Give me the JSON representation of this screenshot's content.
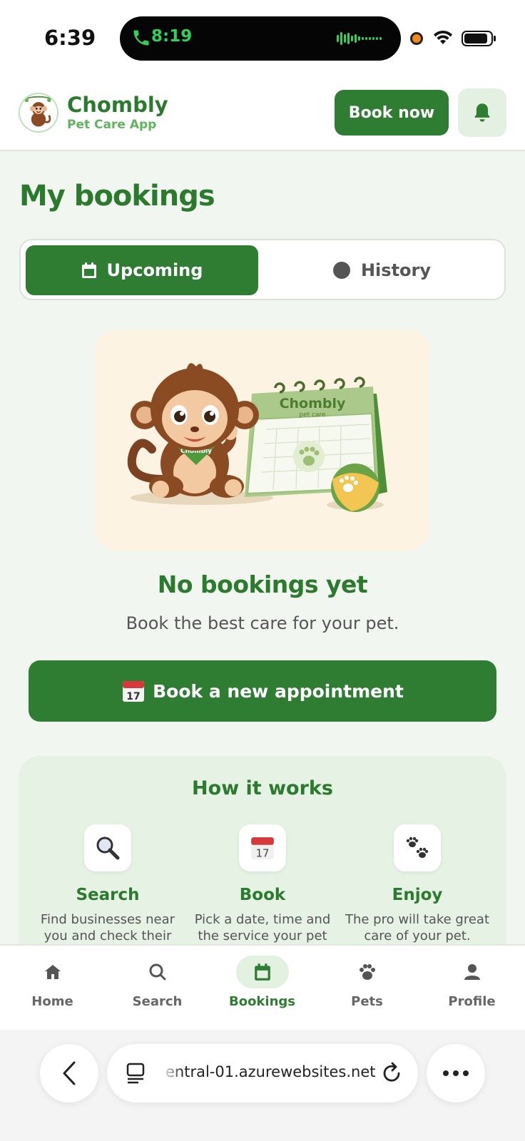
{
  "status_bar": {
    "time": "6:39",
    "call_timer": "8:19"
  },
  "header": {
    "brand_name": "Chombly",
    "brand_tagline": "Pet Care App",
    "book_now_label": "Book now"
  },
  "page": {
    "title": "My bookings",
    "tabs": [
      {
        "label": "Upcoming",
        "icon": "calendar-icon",
        "active": true
      },
      {
        "label": "History",
        "icon": "circle-icon",
        "active": false
      }
    ],
    "illustration": {
      "calendar_brand": "Chombly",
      "calendar_sub": "pet care",
      "bandana_text": "Chombly"
    },
    "empty_title": "No bookings yet",
    "empty_subtitle": "Book the best care for your pet.",
    "new_appointment_label": "Book a new appointment"
  },
  "how_it_works": {
    "title": "How it works",
    "steps": [
      {
        "title": "Search",
        "text_line1": "Find businesses near",
        "text_line2": "you and check their",
        "icon": "magnifier-icon"
      },
      {
        "title": "Book",
        "text_line1": "Pick a date, time and",
        "text_line2": "the service your pet",
        "icon": "calendar-icon"
      },
      {
        "title": "Enjoy",
        "text_line1": "The pro will take great",
        "text_line2": "care of your pet.",
        "icon": "paws-icon"
      }
    ]
  },
  "bottom_nav": {
    "items": [
      {
        "label": "Home",
        "icon": "home-icon",
        "active": false
      },
      {
        "label": "Search",
        "icon": "search-icon",
        "active": false
      },
      {
        "label": "Bookings",
        "icon": "calendar-icon",
        "active": true
      },
      {
        "label": "Pets",
        "icon": "paw-icon",
        "active": false
      },
      {
        "label": "Profile",
        "icon": "person-icon",
        "active": false
      }
    ]
  },
  "browser": {
    "url": "entral-01.azurewebsites.net"
  },
  "colors": {
    "primary": "#2e7d32",
    "primary_light": "#62b35e",
    "background": "#f1f6f0",
    "card_tint": "#e5f2e4",
    "illustration_bg": "#fdf3e3"
  }
}
